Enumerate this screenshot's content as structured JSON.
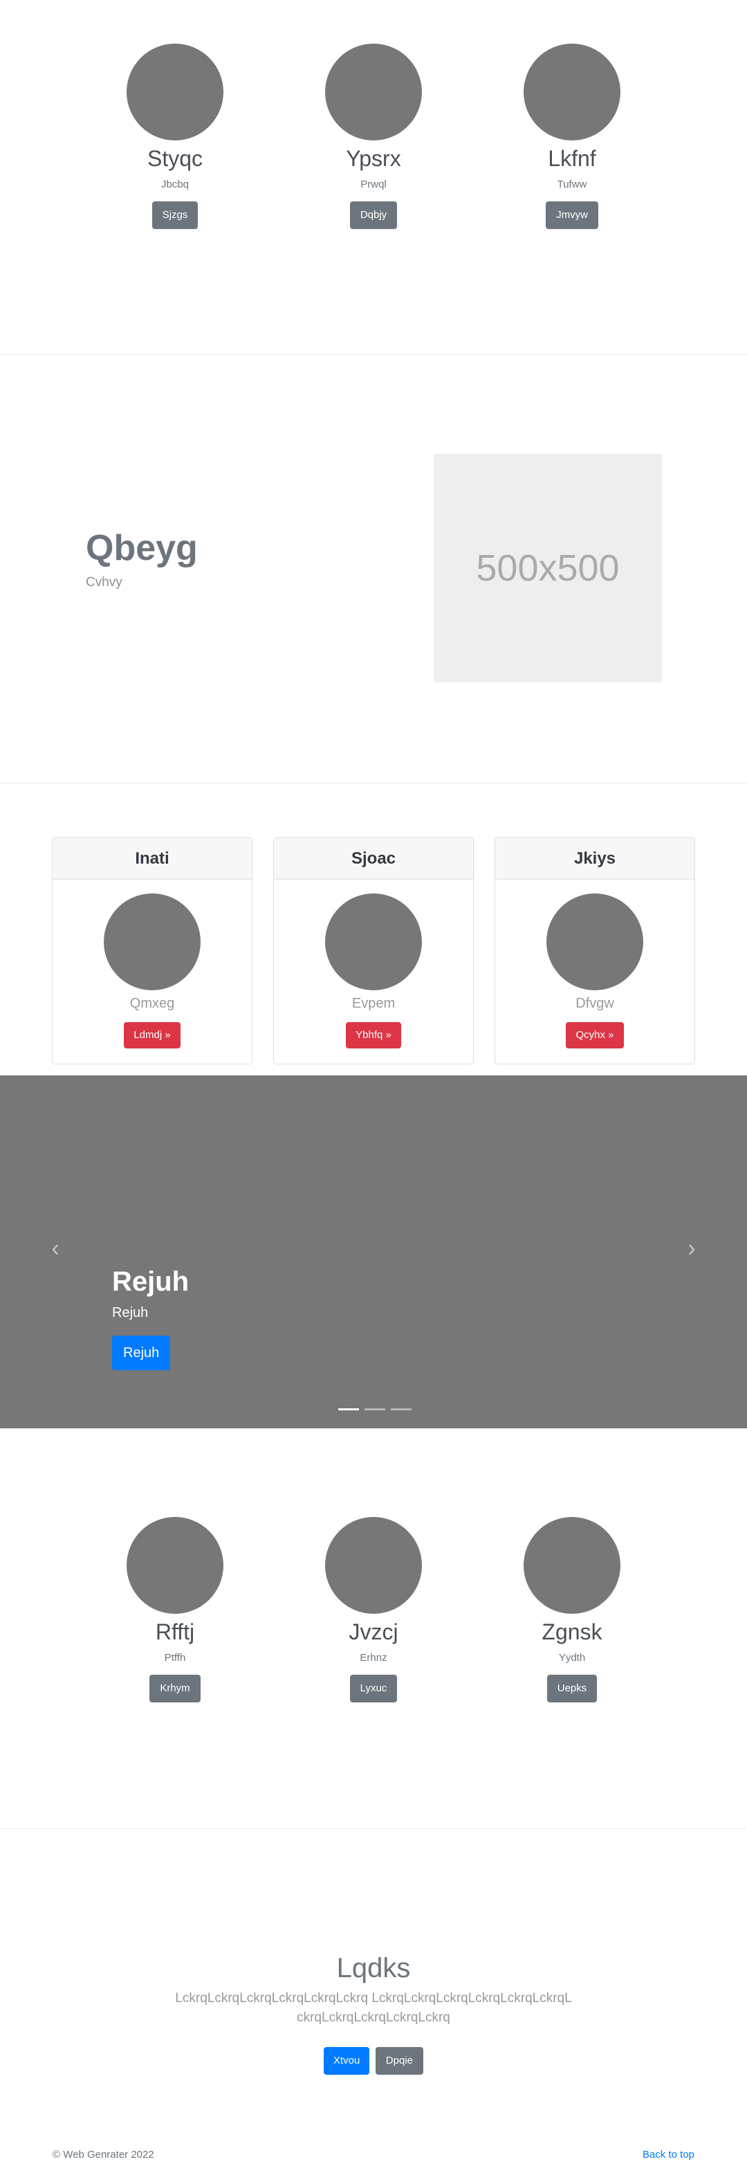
{
  "team_top": {
    "members": [
      {
        "name": "Styqc",
        "role": "Jbcbq",
        "button": "Sjzgs"
      },
      {
        "name": "Ypsrx",
        "role": "Prwql",
        "button": "Dqbjy"
      },
      {
        "name": "Lkfnf",
        "role": "Tufww",
        "button": "Jmvyw"
      }
    ]
  },
  "feature": {
    "title": "Qbeyg",
    "subtitle": "Cvhvy",
    "placeholder_text": "500x500"
  },
  "cards": [
    {
      "header": "Inati",
      "subtitle": "Qmxeg",
      "button": "Ldmdj »"
    },
    {
      "header": "Sjoac",
      "subtitle": "Evpem",
      "button": "Ybhfq »"
    },
    {
      "header": "Jkiys",
      "subtitle": "Dfvgw",
      "button": "Qcyhx »"
    }
  ],
  "carousel": {
    "prev_glyph": "‹",
    "next_glyph": "›",
    "title": "Rejuh",
    "text": "Rejuh",
    "button": "Rejuh",
    "slide_count": 3,
    "active_slide": 1
  },
  "team_bottom": {
    "members": [
      {
        "name": "Rfftj",
        "role": "Ptffh",
        "button": "Krhym"
      },
      {
        "name": "Jvzcj",
        "role": "Erhnz",
        "button": "Lyxuc"
      },
      {
        "name": "Zgnsk",
        "role": "Yydth",
        "button": "Uepks"
      }
    ]
  },
  "cta": {
    "title": "Lqdks",
    "text": "LckrqLckrqLckrqLckrqLckrqLckrq LckrqLckrqLckrqLckrqLckrqLckrqLckrqLckrqLckrqLckrqLckrq",
    "primary_button": "Xtvou",
    "secondary_button": "Dpqie"
  },
  "footer": {
    "copyright": "© Web Genrater 2022",
    "back_to_top": "Back to top"
  },
  "colors": {
    "primary": "#007bff",
    "danger": "#dc3545",
    "secondary": "#6c757d",
    "placeholder": "#777777"
  }
}
